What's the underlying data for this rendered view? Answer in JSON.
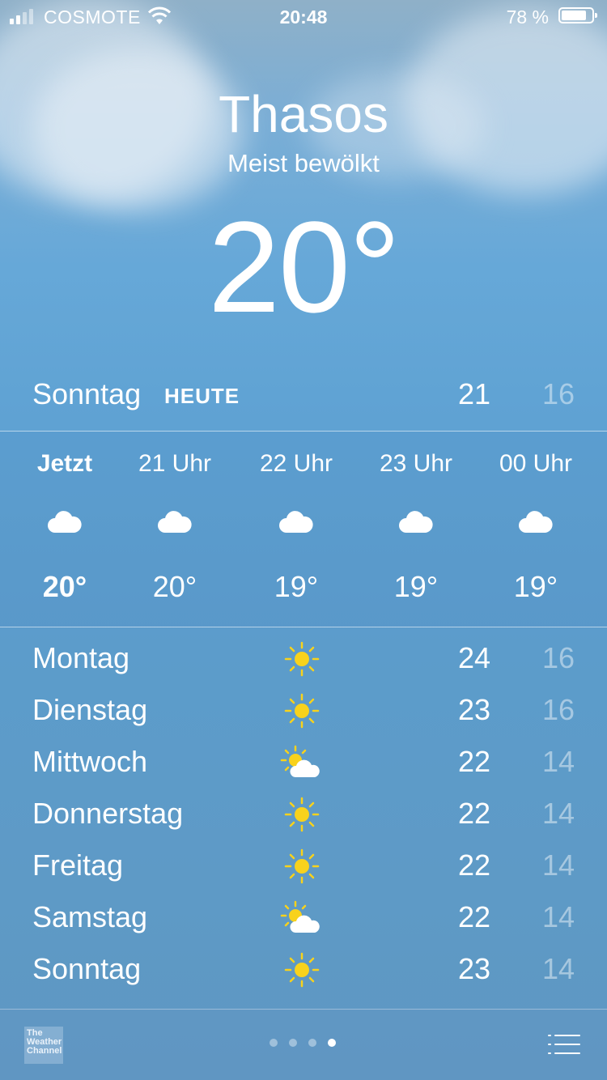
{
  "status": {
    "carrier": "COSMOTE",
    "time": "20:48",
    "battery_text": "78 %",
    "battery_level_percent": 78,
    "signal_bars": 2
  },
  "location": {
    "city": "Thasos",
    "condition": "Meist bewölkt",
    "temperature": "20°"
  },
  "today": {
    "day": "Sonntag",
    "badge": "HEUTE",
    "high": "21",
    "low": "16"
  },
  "hourly": [
    {
      "label": "Jetzt",
      "icon": "cloud-icon",
      "temp": "20°"
    },
    {
      "label": "21 Uhr",
      "icon": "cloud-icon",
      "temp": "20°"
    },
    {
      "label": "22 Uhr",
      "icon": "cloud-icon",
      "temp": "19°"
    },
    {
      "label": "23 Uhr",
      "icon": "cloud-icon",
      "temp": "19°"
    },
    {
      "label": "00 Uhr",
      "icon": "cloud-icon",
      "temp": "19°"
    }
  ],
  "daily": [
    {
      "day": "Montag",
      "icon": "sun-icon",
      "high": "24",
      "low": "16"
    },
    {
      "day": "Dienstag",
      "icon": "sun-icon",
      "high": "23",
      "low": "16"
    },
    {
      "day": "Mittwoch",
      "icon": "partly-cloudy-icon",
      "high": "22",
      "low": "14"
    },
    {
      "day": "Donnerstag",
      "icon": "sun-icon",
      "high": "22",
      "low": "14"
    },
    {
      "day": "Freitag",
      "icon": "sun-icon",
      "high": "22",
      "low": "14"
    },
    {
      "day": "Samstag",
      "icon": "partly-cloudy-icon",
      "high": "22",
      "low": "14"
    },
    {
      "day": "Sonntag",
      "icon": "sun-icon",
      "high": "23",
      "low": "14"
    }
  ],
  "footer": {
    "logo_text": "The Weather Channel",
    "page_count": 4,
    "active_page": 4
  },
  "colors": {
    "sun": "#f8d21c",
    "cloud": "#ffffff",
    "low_temp": "rgba(255,255,255,0.45)"
  }
}
